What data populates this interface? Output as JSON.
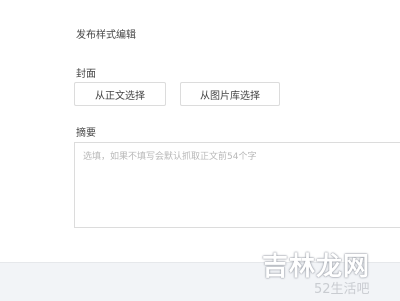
{
  "section": {
    "title": "发布样式编辑"
  },
  "cover": {
    "label": "封面",
    "from_body_button": "从正文选择",
    "from_library_button": "从图片库选择"
  },
  "summary": {
    "label": "摘要",
    "placeholder": "选填，如果不填写会默认抓取正文前54个字",
    "value": ""
  },
  "watermark": {
    "main": "吉林龙网",
    "sub": "52生活吧"
  }
}
